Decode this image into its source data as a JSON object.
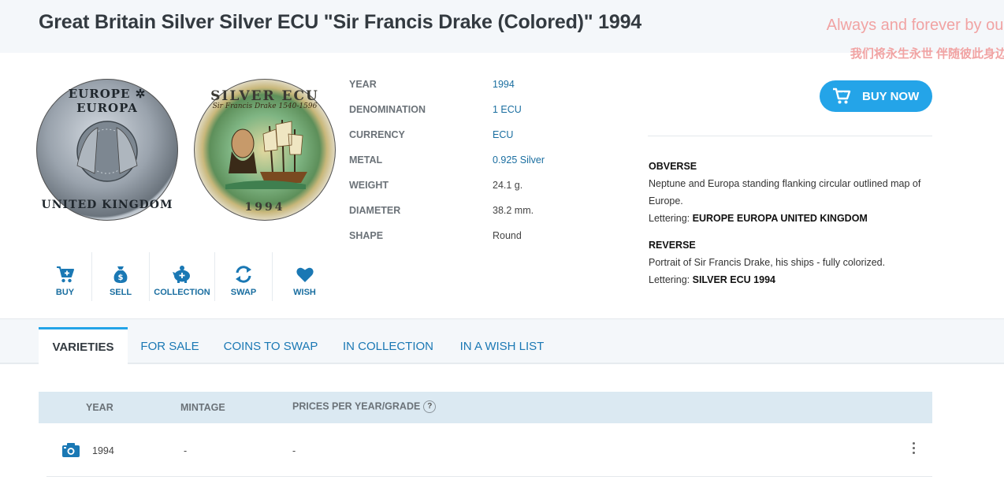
{
  "header": {
    "title": "Great Britain Silver Silver ECU \"Sir Francis Drake (Colored)\" 1994",
    "watermark_line1": "Always and forever by our",
    "watermark_line2": "我们将永生永世 伴随彼此身边"
  },
  "coins": {
    "obverse": {
      "top_text": "EUROPE ✲ EUROPA",
      "bottom_text": "UNITED KINGDOM"
    },
    "reverse": {
      "top_text": "SILVER ECU",
      "small_text": "Sir Francis Drake 1540-1596",
      "bottom_text": "1994"
    }
  },
  "specs": [
    {
      "label": "YEAR",
      "value": "1994",
      "link": true
    },
    {
      "label": "DENOMINATION",
      "value": "1 ECU",
      "link": true
    },
    {
      "label": "CURRENCY",
      "value": "ECU",
      "link": true
    },
    {
      "label": "METAL",
      "value": "0.925 Silver",
      "link": true
    },
    {
      "label": "WEIGHT",
      "value": "24.1 g.",
      "link": false
    },
    {
      "label": "DIAMETER",
      "value": "38.2 mm.",
      "link": false
    },
    {
      "label": "SHAPE",
      "value": "Round",
      "link": false
    }
  ],
  "buy_now": {
    "label": "BUY NOW"
  },
  "description": {
    "obverse": {
      "heading": "OBVERSE",
      "text": "Neptune and Europa standing flanking circular outlined map of Europe.",
      "lettering_label": "Lettering:",
      "lettering": "EUROPE EUROPA UNITED KINGDOM"
    },
    "reverse": {
      "heading": "REVERSE",
      "text": "Portrait of Sir Francis Drake, his ships - fully colorized.",
      "lettering_label": "Lettering:",
      "lettering": "SILVER ECU 1994"
    }
  },
  "actions": [
    {
      "label": "BUY",
      "icon": "cart-icon"
    },
    {
      "label": "SELL",
      "icon": "money-bag-icon"
    },
    {
      "label": "COLLECTION",
      "icon": "piggy-bank-icon"
    },
    {
      "label": "SWAP",
      "icon": "swap-arrows-icon"
    },
    {
      "label": "WISH",
      "icon": "heart-icon"
    }
  ],
  "tabs": [
    {
      "label": "VARIETIES",
      "active": true
    },
    {
      "label": "FOR SALE",
      "active": false
    },
    {
      "label": "COINS TO SWAP",
      "active": false
    },
    {
      "label": "IN COLLECTION",
      "active": false
    },
    {
      "label": "IN A WISH LIST",
      "active": false
    }
  ],
  "table": {
    "columns": [
      "YEAR",
      "MINTAGE",
      "PRICES PER YEAR/GRADE"
    ],
    "help_glyph": "?",
    "rows": [
      {
        "year": "1994",
        "mintage": "-",
        "prices": "-"
      }
    ]
  },
  "colors": {
    "accent": "#24a4e8",
    "link": "#1a6ea0",
    "header_bg": "#f4f7fa",
    "table_head_bg": "#dbe9f2",
    "watermark": "#f1a3a3"
  }
}
